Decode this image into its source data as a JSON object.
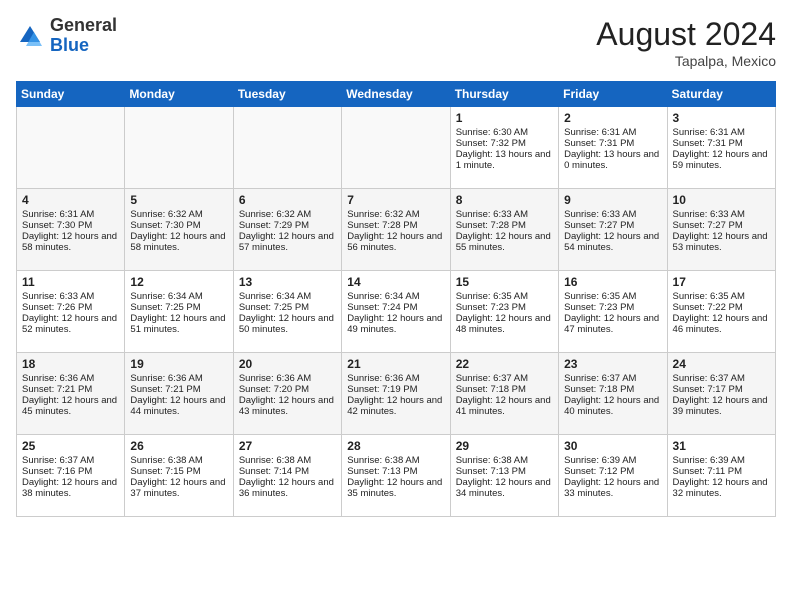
{
  "header": {
    "logo_general": "General",
    "logo_blue": "Blue",
    "month_year": "August 2024",
    "location": "Tapalpa, Mexico"
  },
  "days_of_week": [
    "Sunday",
    "Monday",
    "Tuesday",
    "Wednesday",
    "Thursday",
    "Friday",
    "Saturday"
  ],
  "weeks": [
    [
      {
        "day": "",
        "sunrise": "",
        "sunset": "",
        "daylight": ""
      },
      {
        "day": "",
        "sunrise": "",
        "sunset": "",
        "daylight": ""
      },
      {
        "day": "",
        "sunrise": "",
        "sunset": "",
        "daylight": ""
      },
      {
        "day": "",
        "sunrise": "",
        "sunset": "",
        "daylight": ""
      },
      {
        "day": "1",
        "sunrise": "Sunrise: 6:30 AM",
        "sunset": "Sunset: 7:32 PM",
        "daylight": "Daylight: 13 hours and 1 minute."
      },
      {
        "day": "2",
        "sunrise": "Sunrise: 6:31 AM",
        "sunset": "Sunset: 7:31 PM",
        "daylight": "Daylight: 13 hours and 0 minutes."
      },
      {
        "day": "3",
        "sunrise": "Sunrise: 6:31 AM",
        "sunset": "Sunset: 7:31 PM",
        "daylight": "Daylight: 12 hours and 59 minutes."
      }
    ],
    [
      {
        "day": "4",
        "sunrise": "Sunrise: 6:31 AM",
        "sunset": "Sunset: 7:30 PM",
        "daylight": "Daylight: 12 hours and 58 minutes."
      },
      {
        "day": "5",
        "sunrise": "Sunrise: 6:32 AM",
        "sunset": "Sunset: 7:30 PM",
        "daylight": "Daylight: 12 hours and 58 minutes."
      },
      {
        "day": "6",
        "sunrise": "Sunrise: 6:32 AM",
        "sunset": "Sunset: 7:29 PM",
        "daylight": "Daylight: 12 hours and 57 minutes."
      },
      {
        "day": "7",
        "sunrise": "Sunrise: 6:32 AM",
        "sunset": "Sunset: 7:28 PM",
        "daylight": "Daylight: 12 hours and 56 minutes."
      },
      {
        "day": "8",
        "sunrise": "Sunrise: 6:33 AM",
        "sunset": "Sunset: 7:28 PM",
        "daylight": "Daylight: 12 hours and 55 minutes."
      },
      {
        "day": "9",
        "sunrise": "Sunrise: 6:33 AM",
        "sunset": "Sunset: 7:27 PM",
        "daylight": "Daylight: 12 hours and 54 minutes."
      },
      {
        "day": "10",
        "sunrise": "Sunrise: 6:33 AM",
        "sunset": "Sunset: 7:27 PM",
        "daylight": "Daylight: 12 hours and 53 minutes."
      }
    ],
    [
      {
        "day": "11",
        "sunrise": "Sunrise: 6:33 AM",
        "sunset": "Sunset: 7:26 PM",
        "daylight": "Daylight: 12 hours and 52 minutes."
      },
      {
        "day": "12",
        "sunrise": "Sunrise: 6:34 AM",
        "sunset": "Sunset: 7:25 PM",
        "daylight": "Daylight: 12 hours and 51 minutes."
      },
      {
        "day": "13",
        "sunrise": "Sunrise: 6:34 AM",
        "sunset": "Sunset: 7:25 PM",
        "daylight": "Daylight: 12 hours and 50 minutes."
      },
      {
        "day": "14",
        "sunrise": "Sunrise: 6:34 AM",
        "sunset": "Sunset: 7:24 PM",
        "daylight": "Daylight: 12 hours and 49 minutes."
      },
      {
        "day": "15",
        "sunrise": "Sunrise: 6:35 AM",
        "sunset": "Sunset: 7:23 PM",
        "daylight": "Daylight: 12 hours and 48 minutes."
      },
      {
        "day": "16",
        "sunrise": "Sunrise: 6:35 AM",
        "sunset": "Sunset: 7:23 PM",
        "daylight": "Daylight: 12 hours and 47 minutes."
      },
      {
        "day": "17",
        "sunrise": "Sunrise: 6:35 AM",
        "sunset": "Sunset: 7:22 PM",
        "daylight": "Daylight: 12 hours and 46 minutes."
      }
    ],
    [
      {
        "day": "18",
        "sunrise": "Sunrise: 6:36 AM",
        "sunset": "Sunset: 7:21 PM",
        "daylight": "Daylight: 12 hours and 45 minutes."
      },
      {
        "day": "19",
        "sunrise": "Sunrise: 6:36 AM",
        "sunset": "Sunset: 7:21 PM",
        "daylight": "Daylight: 12 hours and 44 minutes."
      },
      {
        "day": "20",
        "sunrise": "Sunrise: 6:36 AM",
        "sunset": "Sunset: 7:20 PM",
        "daylight": "Daylight: 12 hours and 43 minutes."
      },
      {
        "day": "21",
        "sunrise": "Sunrise: 6:36 AM",
        "sunset": "Sunset: 7:19 PM",
        "daylight": "Daylight: 12 hours and 42 minutes."
      },
      {
        "day": "22",
        "sunrise": "Sunrise: 6:37 AM",
        "sunset": "Sunset: 7:18 PM",
        "daylight": "Daylight: 12 hours and 41 minutes."
      },
      {
        "day": "23",
        "sunrise": "Sunrise: 6:37 AM",
        "sunset": "Sunset: 7:18 PM",
        "daylight": "Daylight: 12 hours and 40 minutes."
      },
      {
        "day": "24",
        "sunrise": "Sunrise: 6:37 AM",
        "sunset": "Sunset: 7:17 PM",
        "daylight": "Daylight: 12 hours and 39 minutes."
      }
    ],
    [
      {
        "day": "25",
        "sunrise": "Sunrise: 6:37 AM",
        "sunset": "Sunset: 7:16 PM",
        "daylight": "Daylight: 12 hours and 38 minutes."
      },
      {
        "day": "26",
        "sunrise": "Sunrise: 6:38 AM",
        "sunset": "Sunset: 7:15 PM",
        "daylight": "Daylight: 12 hours and 37 minutes."
      },
      {
        "day": "27",
        "sunrise": "Sunrise: 6:38 AM",
        "sunset": "Sunset: 7:14 PM",
        "daylight": "Daylight: 12 hours and 36 minutes."
      },
      {
        "day": "28",
        "sunrise": "Sunrise: 6:38 AM",
        "sunset": "Sunset: 7:13 PM",
        "daylight": "Daylight: 12 hours and 35 minutes."
      },
      {
        "day": "29",
        "sunrise": "Sunrise: 6:38 AM",
        "sunset": "Sunset: 7:13 PM",
        "daylight": "Daylight: 12 hours and 34 minutes."
      },
      {
        "day": "30",
        "sunrise": "Sunrise: 6:39 AM",
        "sunset": "Sunset: 7:12 PM",
        "daylight": "Daylight: 12 hours and 33 minutes."
      },
      {
        "day": "31",
        "sunrise": "Sunrise: 6:39 AM",
        "sunset": "Sunset: 7:11 PM",
        "daylight": "Daylight: 12 hours and 32 minutes."
      }
    ]
  ]
}
